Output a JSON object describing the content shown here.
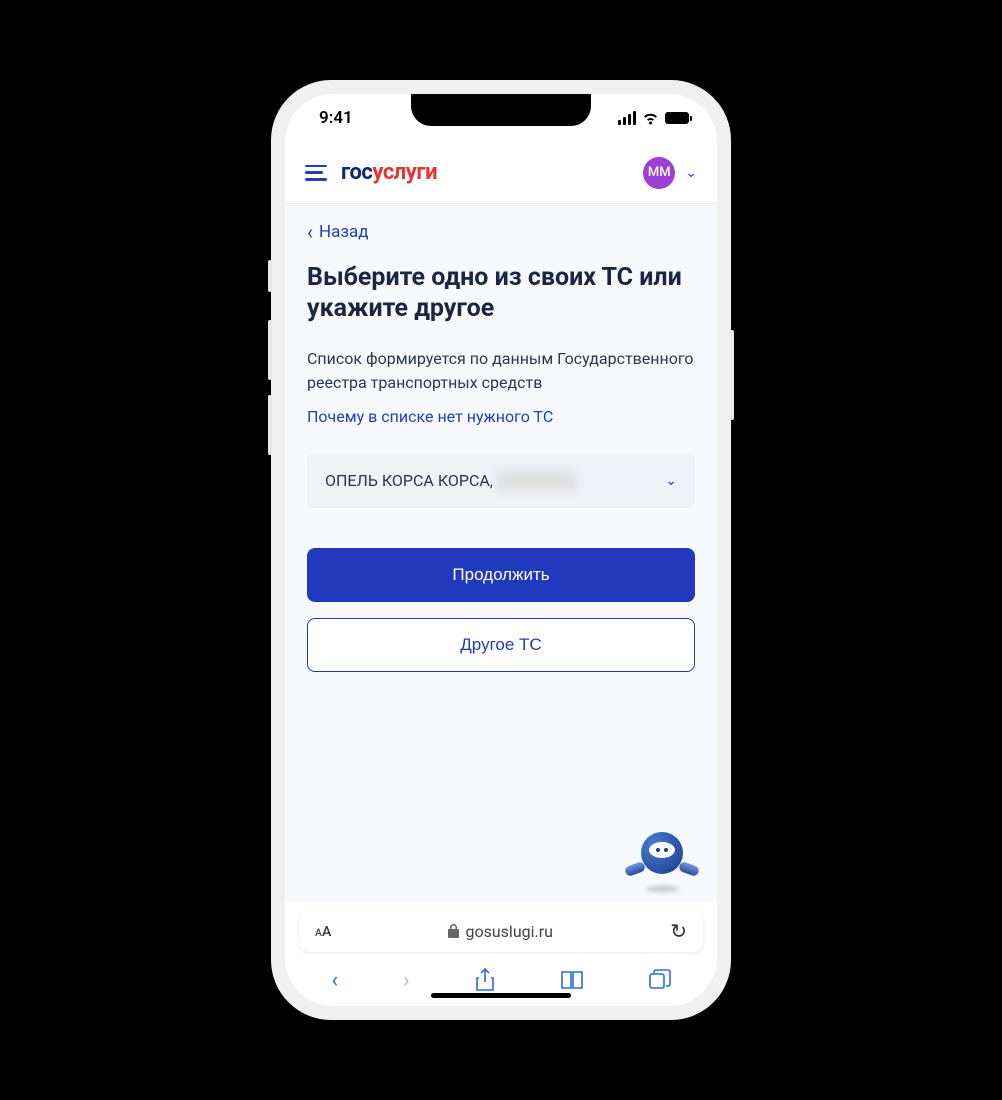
{
  "status": {
    "time": "9:41"
  },
  "header": {
    "logo_part1": "гос",
    "logo_part2": "услуги",
    "avatar_initials": "ММ"
  },
  "content": {
    "back_label": "Назад",
    "title": "Выберите одно из своих ТС или укажите другое",
    "description": "Список формируется по данным Государственного реестра транспортных средств",
    "info_link": "Почему в списке нет нужного ТС",
    "select_value": "ОПЕЛЬ КОРСА КОРСА,",
    "primary_button": "Продолжить",
    "secondary_button": "Другое ТС"
  },
  "browser": {
    "aa_label": "ᴀA",
    "domain": "gosuslugi.ru"
  }
}
